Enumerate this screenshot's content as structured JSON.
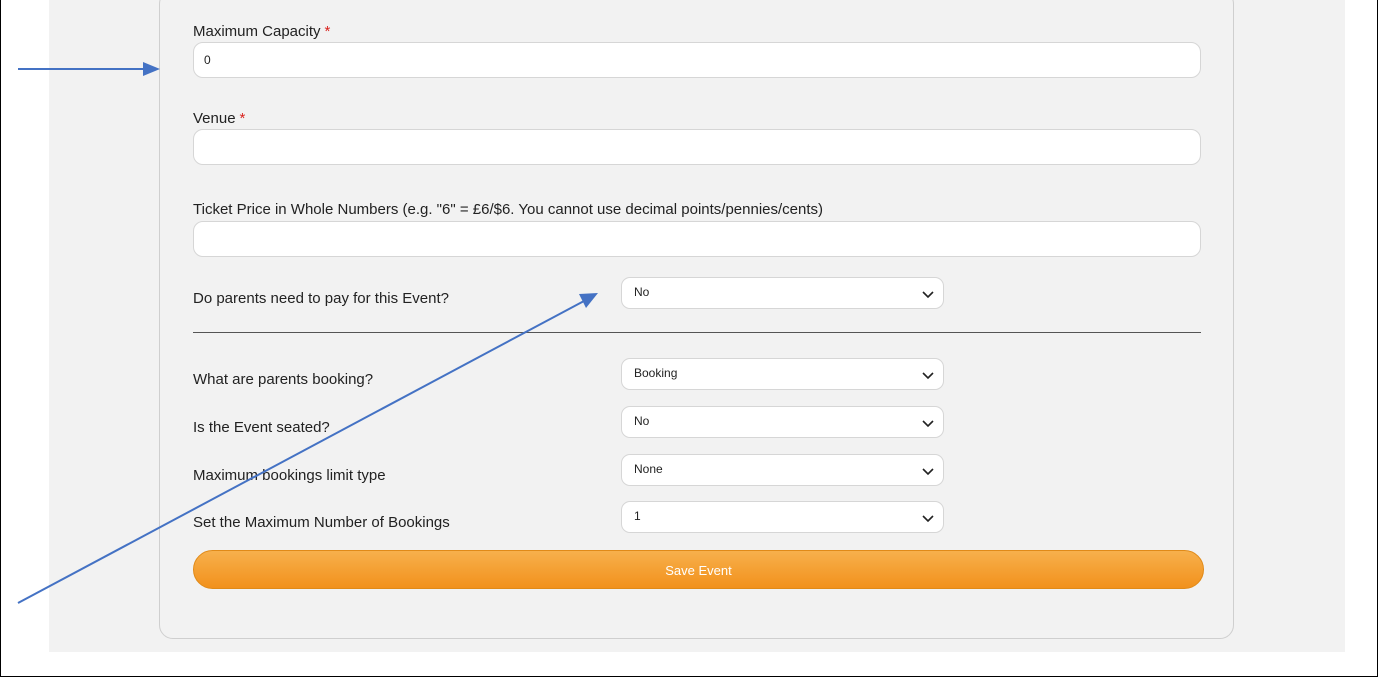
{
  "form": {
    "required_marker": "*",
    "max_capacity": {
      "label": "Maximum Capacity",
      "value": "0"
    },
    "venue": {
      "label": "Venue",
      "value": ""
    },
    "ticket_price": {
      "label": "Ticket Price in Whole Numbers (e.g. \"6\" = £6/$6. You cannot use decimal points/pennies/cents)",
      "value": ""
    },
    "parents_pay": {
      "label": "Do parents need to pay for this Event?",
      "selected": "No"
    },
    "booking_type": {
      "label": "What are parents booking?",
      "selected": "Booking"
    },
    "seated": {
      "label": "Is the Event seated?",
      "selected": "No"
    },
    "limit_type": {
      "label": "Maximum bookings limit type",
      "selected": "None"
    },
    "max_bookings": {
      "label": "Set the Maximum Number of Bookings",
      "selected": "1"
    },
    "save_label": "Save Event"
  },
  "colors": {
    "accent_orange": "#f2911c",
    "required_red": "#d9231f",
    "annotation_arrow": "#4472c4"
  }
}
